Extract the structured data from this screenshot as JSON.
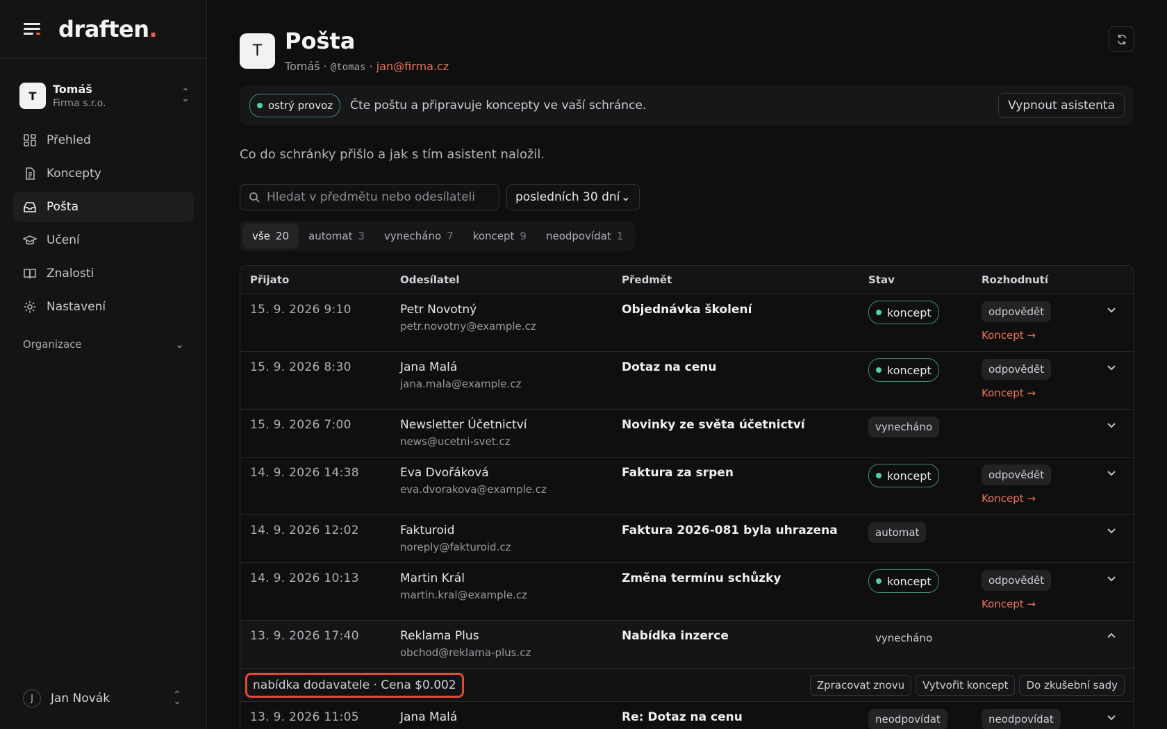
{
  "brand": {
    "name": "draften",
    "dot": "."
  },
  "org": {
    "avatar": "T",
    "name": "Tomáš",
    "sub": "Firma s.r.o."
  },
  "nav": [
    {
      "label": "Přehled",
      "icon": "dashboard-icon"
    },
    {
      "label": "Koncepty",
      "icon": "document-icon"
    },
    {
      "label": "Pošta",
      "icon": "inbox-icon"
    },
    {
      "label": "Učení",
      "icon": "graduation-cap-icon"
    },
    {
      "label": "Znalosti",
      "icon": "book-icon"
    },
    {
      "label": "Nastavení",
      "icon": "gear-icon"
    }
  ],
  "section_label": "Organizace",
  "user": {
    "initial": "J",
    "name": "Jan Novák"
  },
  "header": {
    "avatar": "T",
    "title": "Pošta",
    "name": "Tomáš",
    "handle": "@tomas",
    "email": "jan@firma.cz",
    "sep": "·"
  },
  "banner": {
    "pill": "ostrý provoz",
    "text": "Čte poštu a připravuje koncepty ve vaší schránce.",
    "button": "Vypnout asistenta"
  },
  "intro": "Co do schránky přišlo a jak s tím asistent naložil.",
  "search": {
    "placeholder": "Hledat v předmětu nebo odesílateli"
  },
  "period": {
    "value": "posledních 30 dní"
  },
  "tabs": [
    {
      "label": "vše",
      "count": "20"
    },
    {
      "label": "automat",
      "count": "3"
    },
    {
      "label": "vynecháno",
      "count": "7"
    },
    {
      "label": "koncept",
      "count": "9"
    },
    {
      "label": "neodpovídat",
      "count": "1"
    }
  ],
  "columns": [
    "Přijato",
    "Odesílatel",
    "Předmět",
    "Stav",
    "Rozhodnutí"
  ],
  "rows": [
    {
      "date": "15. 9. 2026 9:10",
      "name": "Petr Novotný",
      "email": "petr.novotny@example.cz",
      "subject": "Objednávka školení",
      "status": "koncept",
      "decision": "odpovědět",
      "link": "Koncept →"
    },
    {
      "date": "15. 9. 2026 8:30",
      "name": "Jana Malá",
      "email": "jana.mala@example.cz",
      "subject": "Dotaz na cenu",
      "status": "koncept",
      "decision": "odpovědět",
      "link": "Koncept →"
    },
    {
      "date": "15. 9. 2026 7:00",
      "name": "Newsletter Účetnictví",
      "email": "news@ucetni-svet.cz",
      "subject": "Novinky ze světa účetnictví",
      "status": "vynecháno"
    },
    {
      "date": "14. 9. 2026 14:38",
      "name": "Eva Dvořáková",
      "email": "eva.dvorakova@example.cz",
      "subject": "Faktura za srpen",
      "status": "koncept",
      "decision": "odpovědět",
      "link": "Koncept →"
    },
    {
      "date": "14. 9. 2026 12:02",
      "name": "Fakturoid",
      "email": "noreply@fakturoid.cz",
      "subject": "Faktura 2026-081 byla uhrazena",
      "status": "automat"
    },
    {
      "date": "14. 9. 2026 10:13",
      "name": "Martin Král",
      "email": "martin.kral@example.cz",
      "subject": "Změna termínu schůzky",
      "status": "koncept",
      "decision": "odpovědět",
      "link": "Koncept →"
    },
    {
      "date": "13. 9. 2026 17:40",
      "name": "Reklama Plus",
      "email": "obchod@reklama-plus.cz",
      "subject": "Nabídka inzerce",
      "status": "vynecháno"
    },
    {
      "date": "13. 9. 2026 11:05",
      "name": "Jana Malá",
      "email": "",
      "subject": "Re: Dotaz na cenu",
      "status": "neodpovídat",
      "decision": "neodpovídat"
    }
  ],
  "detail": {
    "note": "nabídka dodavatele · Cena $0.002",
    "actions": [
      "Zpracovat znovu",
      "Vytvořit koncept",
      "Do zkušební sady"
    ]
  },
  "colors": {
    "accent": "#ec7358",
    "live": "#4fd1a5",
    "highlight": "#e24a38"
  }
}
